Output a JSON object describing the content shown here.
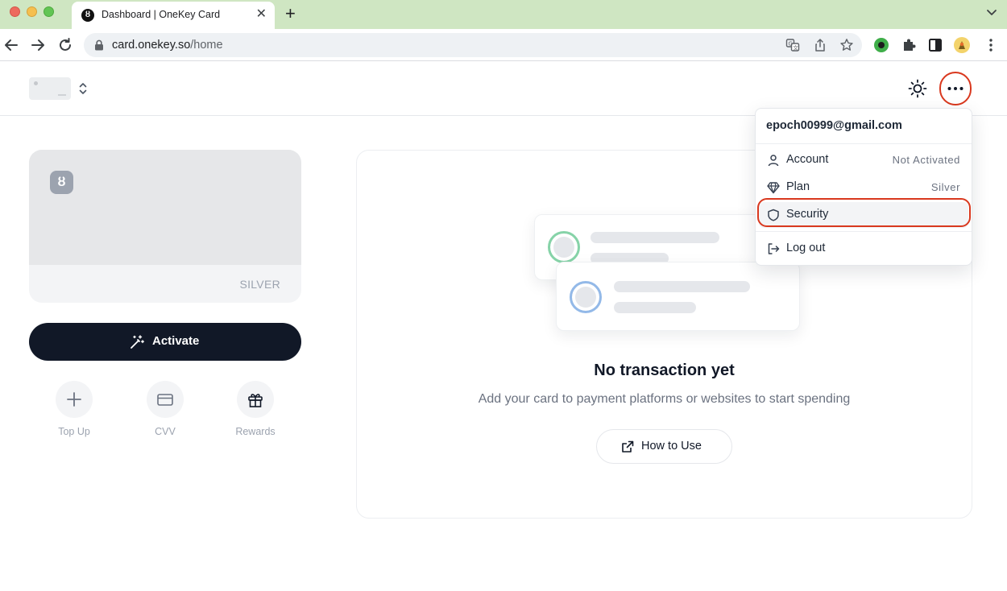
{
  "browser": {
    "tab_title": "Dashboard | OneKey Card",
    "tab_favicon": "ȣ",
    "url_host": "card.onekey.so",
    "url_path": "/home"
  },
  "icons": {
    "back": "arrow-left-icon",
    "forward": "arrow-right-icon",
    "reload": "reload-icon",
    "lock": "lock-icon",
    "translate": "translate-icon",
    "share": "share-icon",
    "bookmark": "star-icon",
    "extensions": "puzzle-icon",
    "sidepanel": "sidepanel-icon",
    "profile": "avatar-icon",
    "kebab": "vertical-dots-icon",
    "theme": "sun-icon",
    "more": "more-horizontal-icon"
  },
  "card": {
    "logo": "ȣ",
    "tier": "SILVER"
  },
  "actions": {
    "activate": "Activate",
    "top_up": "Top Up",
    "cvv": "CVV",
    "rewards": "Rewards"
  },
  "empty_state": {
    "title": "No transaction yet",
    "subtitle": "Add your card to payment platforms or websites to start spending",
    "how_to_use": "How to Use"
  },
  "menu": {
    "email": "epoch00999@gmail.com",
    "items": [
      {
        "label": "Account",
        "value": "Not Activated",
        "icon": "user-icon"
      },
      {
        "label": "Plan",
        "value": "Silver",
        "icon": "diamond-icon"
      },
      {
        "label": "Security",
        "value": "",
        "icon": "shield-icon"
      },
      {
        "label": "Log out",
        "value": "",
        "icon": "logout-icon"
      }
    ]
  },
  "colors": {
    "accent_dark": "#111827",
    "highlight_red": "#d9381e",
    "tab_bar": "#cfe6c2"
  }
}
